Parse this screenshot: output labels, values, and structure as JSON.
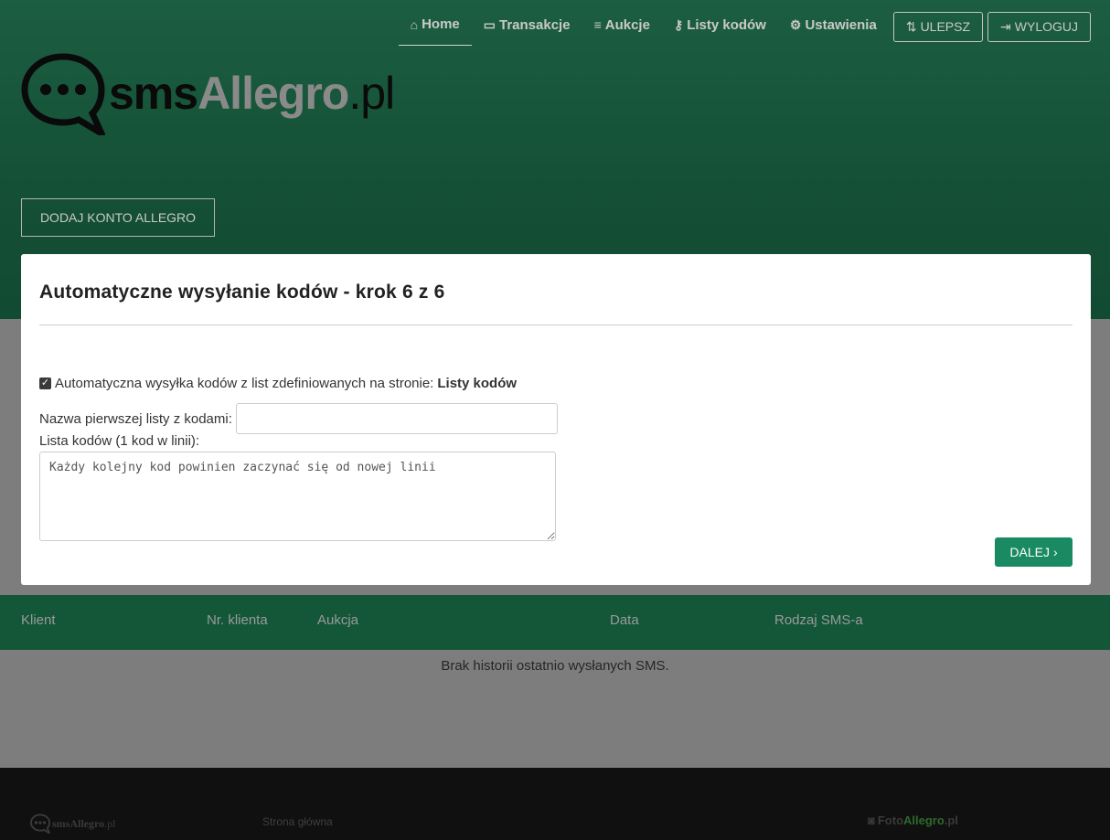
{
  "nav": {
    "items": [
      {
        "label": "Home",
        "icon": "home-icon",
        "active": true
      },
      {
        "label": "Transakcje",
        "icon": "wallet-icon"
      },
      {
        "label": "Aukcje",
        "icon": "list-icon"
      },
      {
        "label": "Listy kodów",
        "icon": "key-icon"
      },
      {
        "label": "Ustawienia",
        "icon": "cogs-icon"
      }
    ],
    "upgrade_label": "ULEPSZ",
    "logout_label": "WYLOGUJ"
  },
  "logo": {
    "part1": "sms",
    "part2": "Allegro",
    "part3": ".pl"
  },
  "add_account_label": "DODAJ KONTO ALLEGRO",
  "modal": {
    "title": "Automatyczne wysyłanie kodów - krok 6 z 6",
    "checkbox_text": "Automatyczna wysyłka kodów z list zdefiniowanych na stronie:",
    "checkbox_link": "Listy kodów",
    "checkbox_checked": true,
    "name_label": "Nazwa pierwszej listy z kodami:",
    "name_value": "",
    "list_label": "Lista kodów (1 kod w linii):",
    "textarea_placeholder": "Każdy kolejny kod powinien zaczynać się od nowej linii",
    "next_label": "DALEJ"
  },
  "table": {
    "headers": [
      "Klient",
      "Nr. klienta",
      "Aukcja",
      "Data",
      "Rodzaj SMS-a"
    ],
    "empty_text": "Brak historii ostatnio wysłanych SMS."
  },
  "footer": {
    "logo_part1": "sms",
    "logo_part2": "Allegro",
    "logo_part3": ".pl",
    "link_home": "Strona główna",
    "foto_part1": "Foto",
    "foto_part2": "Allegro",
    "foto_part3": ".pl"
  },
  "colors": {
    "accent": "#1a8a62",
    "header_green": "#2f9d6e",
    "table_band": "#135738",
    "footer": "#101010"
  }
}
